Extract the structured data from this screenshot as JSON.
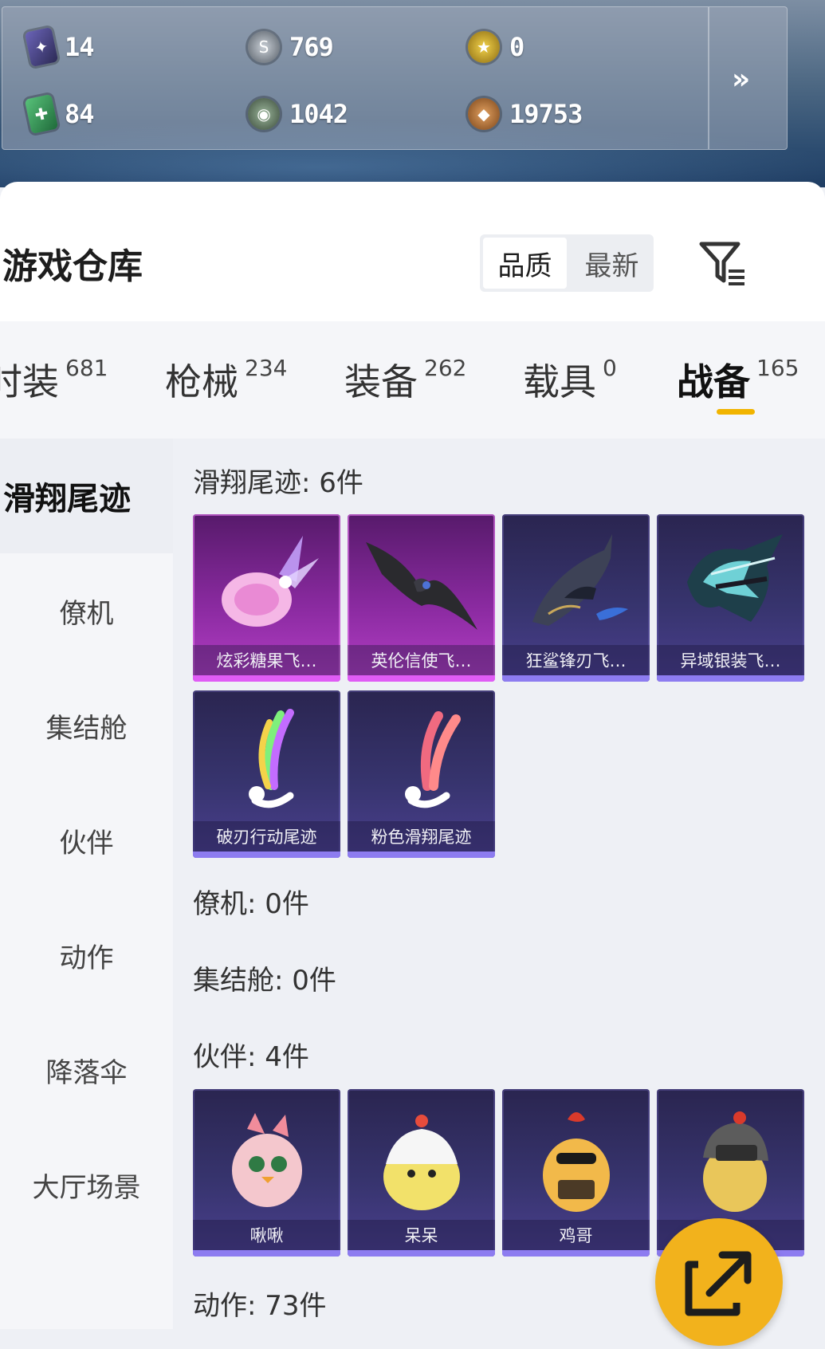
{
  "currencies": [
    {
      "icon": "purple-card-icon",
      "value": "14"
    },
    {
      "icon": "silver-coin-icon",
      "value": "769"
    },
    {
      "icon": "gold-coin-icon",
      "value": "0"
    },
    {
      "icon": "green-card-icon",
      "value": "84"
    },
    {
      "icon": "bronze-coin-icon",
      "value": "1042"
    },
    {
      "icon": "copper-medal-icon",
      "value": "19753"
    }
  ],
  "more_label": "»",
  "header": {
    "title": "游戏仓库",
    "sort_options": [
      "品质",
      "最新"
    ],
    "active_sort": "品质"
  },
  "tabs": [
    {
      "label": "时装",
      "count": "681"
    },
    {
      "label": "枪械",
      "count": "234"
    },
    {
      "label": "装备",
      "count": "262"
    },
    {
      "label": "载具",
      "count": "0"
    },
    {
      "label": "战备",
      "count": "165"
    }
  ],
  "active_tab": "战备",
  "sidebar": [
    "滑翔尾迹",
    "僚机",
    "集结舱",
    "伙伴",
    "动作",
    "降落伞",
    "大厅场景"
  ],
  "sections": {
    "glide_trails": {
      "title": "滑翔尾迹: 6件",
      "items": [
        "炫彩糖果飞…",
        "英伦信使飞…",
        "狂鲨锋刃飞…",
        "异域银装飞…",
        "破刃行动尾迹",
        "粉色滑翔尾迹"
      ]
    },
    "wingman": {
      "title": "僚机: 0件"
    },
    "capsule": {
      "title": "集结舱: 0件"
    },
    "partner": {
      "title": "伙伴: 4件",
      "items": [
        "啾啾",
        "呆呆",
        "鸡哥",
        ""
      ]
    },
    "emote": {
      "title": "动作: 73件"
    }
  },
  "colors": {
    "accent": "#f1b400",
    "fab": "#f2b21c",
    "legendary": "#b43fc6",
    "epic": "#4a3f8e"
  }
}
